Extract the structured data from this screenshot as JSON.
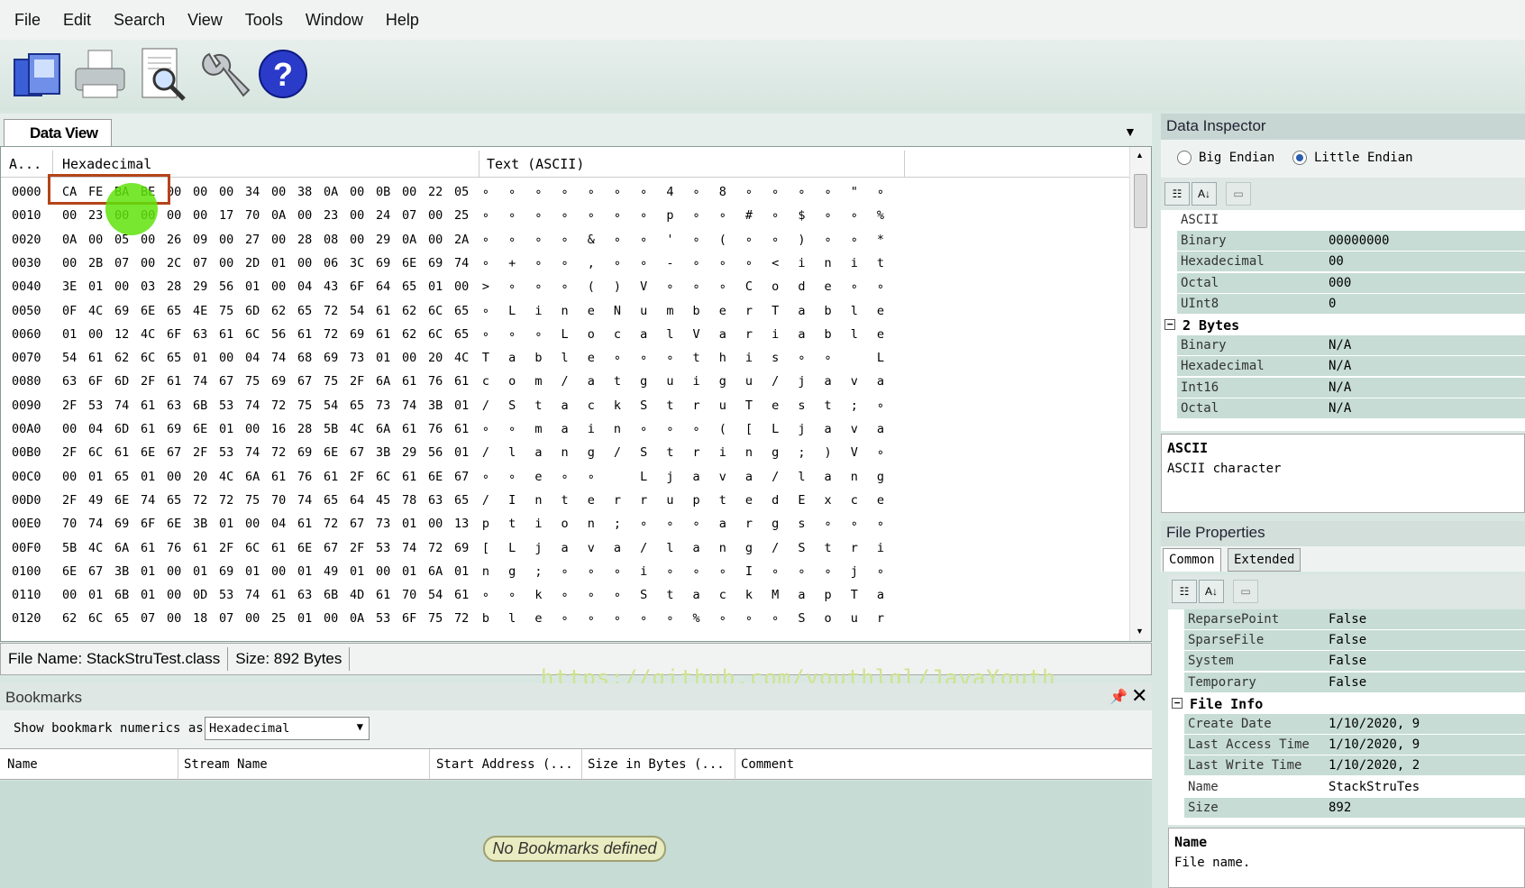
{
  "menu": [
    "File",
    "Edit",
    "Search",
    "View",
    "Tools",
    "Window",
    "Help"
  ],
  "toolbar": {
    "icons": [
      "open-file-icon",
      "print-icon",
      "print-preview-icon",
      "tools-icon",
      "help-icon"
    ],
    "brand_color": "#2a3ac9"
  },
  "data_view": {
    "tab_label": "Data View",
    "col_address": "A...",
    "col_hex": "Hexadecimal",
    "col_text": "Text (ASCII)",
    "rows": [
      {
        "addr": "0000",
        "hex": [
          "CA",
          "FE",
          "BA",
          "BE",
          "00",
          "00",
          "00",
          "34",
          "00",
          "38",
          "0A",
          "00",
          "0B",
          "00",
          "22",
          "05"
        ],
        "text": [
          "∘",
          "∘",
          "∘",
          "∘",
          "∘",
          "∘",
          "∘",
          "4",
          "∘",
          "8",
          "∘",
          "∘",
          "∘",
          "∘",
          "\"",
          "∘"
        ]
      },
      {
        "addr": "0010",
        "hex": [
          "00",
          "23",
          "00",
          "00",
          "00",
          "00",
          "17",
          "70",
          "0A",
          "00",
          "23",
          "00",
          "24",
          "07",
          "00",
          "25"
        ],
        "text": [
          "∘",
          "∘",
          "∘",
          "∘",
          "∘",
          "∘",
          "∘",
          "p",
          "∘",
          "∘",
          "#",
          "∘",
          "$",
          "∘",
          "∘",
          "%"
        ]
      },
      {
        "addr": "0020",
        "hex": [
          "0A",
          "00",
          "05",
          "00",
          "26",
          "09",
          "00",
          "27",
          "00",
          "28",
          "08",
          "00",
          "29",
          "0A",
          "00",
          "2A"
        ],
        "text": [
          "∘",
          "∘",
          "∘",
          "∘",
          "&",
          "∘",
          "∘",
          "'",
          "∘",
          "(",
          "∘",
          "∘",
          ")",
          "∘",
          "∘",
          "*"
        ]
      },
      {
        "addr": "0030",
        "hex": [
          "00",
          "2B",
          "07",
          "00",
          "2C",
          "07",
          "00",
          "2D",
          "01",
          "00",
          "06",
          "3C",
          "69",
          "6E",
          "69",
          "74"
        ],
        "text": [
          "∘",
          "+",
          "∘",
          "∘",
          ",",
          "∘",
          "∘",
          "-",
          "∘",
          "∘",
          "∘",
          "<",
          "i",
          "n",
          "i",
          "t"
        ]
      },
      {
        "addr": "0040",
        "hex": [
          "3E",
          "01",
          "00",
          "03",
          "28",
          "29",
          "56",
          "01",
          "00",
          "04",
          "43",
          "6F",
          "64",
          "65",
          "01",
          "00"
        ],
        "text": [
          ">",
          "∘",
          "∘",
          "∘",
          "(",
          ")",
          "V",
          "∘",
          "∘",
          "∘",
          "C",
          "o",
          "d",
          "e",
          "∘",
          "∘"
        ]
      },
      {
        "addr": "0050",
        "hex": [
          "0F",
          "4C",
          "69",
          "6E",
          "65",
          "4E",
          "75",
          "6D",
          "62",
          "65",
          "72",
          "54",
          "61",
          "62",
          "6C",
          "65"
        ],
        "text": [
          "∘",
          "L",
          "i",
          "n",
          "e",
          "N",
          "u",
          "m",
          "b",
          "e",
          "r",
          "T",
          "a",
          "b",
          "l",
          "e"
        ]
      },
      {
        "addr": "0060",
        "hex": [
          "01",
          "00",
          "12",
          "4C",
          "6F",
          "63",
          "61",
          "6C",
          "56",
          "61",
          "72",
          "69",
          "61",
          "62",
          "6C",
          "65"
        ],
        "text": [
          "∘",
          "∘",
          "∘",
          "L",
          "o",
          "c",
          "a",
          "l",
          "V",
          "a",
          "r",
          "i",
          "a",
          "b",
          "l",
          "e"
        ]
      },
      {
        "addr": "0070",
        "hex": [
          "54",
          "61",
          "62",
          "6C",
          "65",
          "01",
          "00",
          "04",
          "74",
          "68",
          "69",
          "73",
          "01",
          "00",
          "20",
          "4C"
        ],
        "text": [
          "T",
          "a",
          "b",
          "l",
          "e",
          "∘",
          "∘",
          "∘",
          "t",
          "h",
          "i",
          "s",
          "∘",
          "∘",
          " ",
          "L"
        ]
      },
      {
        "addr": "0080",
        "hex": [
          "63",
          "6F",
          "6D",
          "2F",
          "61",
          "74",
          "67",
          "75",
          "69",
          "67",
          "75",
          "2F",
          "6A",
          "61",
          "76",
          "61"
        ],
        "text": [
          "c",
          "o",
          "m",
          "/",
          "a",
          "t",
          "g",
          "u",
          "i",
          "g",
          "u",
          "/",
          "j",
          "a",
          "v",
          "a"
        ]
      },
      {
        "addr": "0090",
        "hex": [
          "2F",
          "53",
          "74",
          "61",
          "63",
          "6B",
          "53",
          "74",
          "72",
          "75",
          "54",
          "65",
          "73",
          "74",
          "3B",
          "01"
        ],
        "text": [
          "/",
          "S",
          "t",
          "a",
          "c",
          "k",
          "S",
          "t",
          "r",
          "u",
          "T",
          "e",
          "s",
          "t",
          ";",
          "∘"
        ]
      },
      {
        "addr": "00A0",
        "hex": [
          "00",
          "04",
          "6D",
          "61",
          "69",
          "6E",
          "01",
          "00",
          "16",
          "28",
          "5B",
          "4C",
          "6A",
          "61",
          "76",
          "61"
        ],
        "text": [
          "∘",
          "∘",
          "m",
          "a",
          "i",
          "n",
          "∘",
          "∘",
          "∘",
          "(",
          "[",
          "L",
          "j",
          "a",
          "v",
          "a"
        ]
      },
      {
        "addr": "00B0",
        "hex": [
          "2F",
          "6C",
          "61",
          "6E",
          "67",
          "2F",
          "53",
          "74",
          "72",
          "69",
          "6E",
          "67",
          "3B",
          "29",
          "56",
          "01"
        ],
        "text": [
          "/",
          "l",
          "a",
          "n",
          "g",
          "/",
          "S",
          "t",
          "r",
          "i",
          "n",
          "g",
          ";",
          ")",
          "V",
          "∘"
        ]
      },
      {
        "addr": "00C0",
        "hex": [
          "00",
          "01",
          "65",
          "01",
          "00",
          "20",
          "4C",
          "6A",
          "61",
          "76",
          "61",
          "2F",
          "6C",
          "61",
          "6E",
          "67"
        ],
        "text": [
          "∘",
          "∘",
          "e",
          "∘",
          "∘",
          " ",
          "L",
          "j",
          "a",
          "v",
          "a",
          "/",
          "l",
          "a",
          "n",
          "g"
        ]
      },
      {
        "addr": "00D0",
        "hex": [
          "2F",
          "49",
          "6E",
          "74",
          "65",
          "72",
          "72",
          "75",
          "70",
          "74",
          "65",
          "64",
          "45",
          "78",
          "63",
          "65"
        ],
        "text": [
          "/",
          "I",
          "n",
          "t",
          "e",
          "r",
          "r",
          "u",
          "p",
          "t",
          "e",
          "d",
          "E",
          "x",
          "c",
          "e"
        ]
      },
      {
        "addr": "00E0",
        "hex": [
          "70",
          "74",
          "69",
          "6F",
          "6E",
          "3B",
          "01",
          "00",
          "04",
          "61",
          "72",
          "67",
          "73",
          "01",
          "00",
          "13"
        ],
        "text": [
          "p",
          "t",
          "i",
          "o",
          "n",
          ";",
          "∘",
          "∘",
          "∘",
          "a",
          "r",
          "g",
          "s",
          "∘",
          "∘",
          "∘"
        ]
      },
      {
        "addr": "00F0",
        "hex": [
          "5B",
          "4C",
          "6A",
          "61",
          "76",
          "61",
          "2F",
          "6C",
          "61",
          "6E",
          "67",
          "2F",
          "53",
          "74",
          "72",
          "69"
        ],
        "text": [
          "[",
          "L",
          "j",
          "a",
          "v",
          "a",
          "/",
          "l",
          "a",
          "n",
          "g",
          "/",
          "S",
          "t",
          "r",
          "i"
        ]
      },
      {
        "addr": "0100",
        "hex": [
          "6E",
          "67",
          "3B",
          "01",
          "00",
          "01",
          "69",
          "01",
          "00",
          "01",
          "49",
          "01",
          "00",
          "01",
          "6A",
          "01"
        ],
        "text": [
          "n",
          "g",
          ";",
          "∘",
          "∘",
          "∘",
          "i",
          "∘",
          "∘",
          "∘",
          "I",
          "∘",
          "∘",
          "∘",
          "j",
          "∘"
        ]
      },
      {
        "addr": "0110",
        "hex": [
          "00",
          "01",
          "6B",
          "01",
          "00",
          "0D",
          "53",
          "74",
          "61",
          "63",
          "6B",
          "4D",
          "61",
          "70",
          "54",
          "61"
        ],
        "text": [
          "∘",
          "∘",
          "k",
          "∘",
          "∘",
          "∘",
          "S",
          "t",
          "a",
          "c",
          "k",
          "M",
          "a",
          "p",
          "T",
          "a"
        ]
      },
      {
        "addr": "0120",
        "hex": [
          "62",
          "6C",
          "65",
          "07",
          "00",
          "18",
          "07",
          "00",
          "25",
          "01",
          "00",
          "0A",
          "53",
          "6F",
          "75",
          "72"
        ],
        "text": [
          "b",
          "l",
          "e",
          "∘",
          "∘",
          "∘",
          "∘",
          "∘",
          "%",
          "∘",
          "∘",
          "∘",
          "S",
          "o",
          "u",
          "r"
        ]
      }
    ],
    "highlight_color": "#b5441a"
  },
  "status": {
    "file_name": "File Name: StackStruTest.class",
    "size": "Size: 892 Bytes"
  },
  "watermark": "https://github.com/youthlql/JavaYouth",
  "bookmarks": {
    "title": "Bookmarks",
    "show_label": "Show bookmark numerics as",
    "numeric_mode": "Hexadecimal",
    "columns": [
      "Name",
      "Stream Name",
      "Start Address (...",
      "Size in Bytes (...",
      "Comment"
    ],
    "empty_text": "No Bookmarks defined"
  },
  "data_inspector": {
    "title": "Data Inspector",
    "big_endian": "Big Endian",
    "little_endian": "Little Endian",
    "selected_endian": "Little Endian",
    "rows_1": [
      {
        "k": "ASCII",
        "v": ""
      },
      {
        "k": "Binary",
        "v": "00000000"
      },
      {
        "k": "Hexadecimal",
        "v": "00"
      },
      {
        "k": "Octal",
        "v": "000"
      },
      {
        "k": "UInt8",
        "v": "0"
      }
    ],
    "cat_2": "2 Bytes",
    "rows_2": [
      {
        "k": "Binary",
        "v": "N/A"
      },
      {
        "k": "Hexadecimal",
        "v": "N/A"
      },
      {
        "k": "Int16",
        "v": "N/A"
      },
      {
        "k": "Octal",
        "v": "N/A"
      }
    ],
    "desc_title": "ASCII",
    "desc_text": "ASCII character"
  },
  "file_properties": {
    "title": "File Properties",
    "tab_common": "Common",
    "tab_extended": "Extended",
    "rows_1": [
      {
        "k": "ReparsePoint",
        "v": "False"
      },
      {
        "k": "SparseFile",
        "v": "False"
      },
      {
        "k": "System",
        "v": "False"
      },
      {
        "k": "Temporary",
        "v": "False"
      }
    ],
    "cat_2": "File Info",
    "rows_2": [
      {
        "k": "Create Date",
        "v": "1/10/2020, 9"
      },
      {
        "k": "Last Access Time",
        "v": "1/10/2020, 9"
      },
      {
        "k": "Last Write Time",
        "v": "1/10/2020, 2"
      },
      {
        "k": "Name",
        "v": "StackStruTes"
      },
      {
        "k": "Size",
        "v": "892"
      }
    ],
    "desc_title": "Name",
    "desc_text": "File name."
  }
}
